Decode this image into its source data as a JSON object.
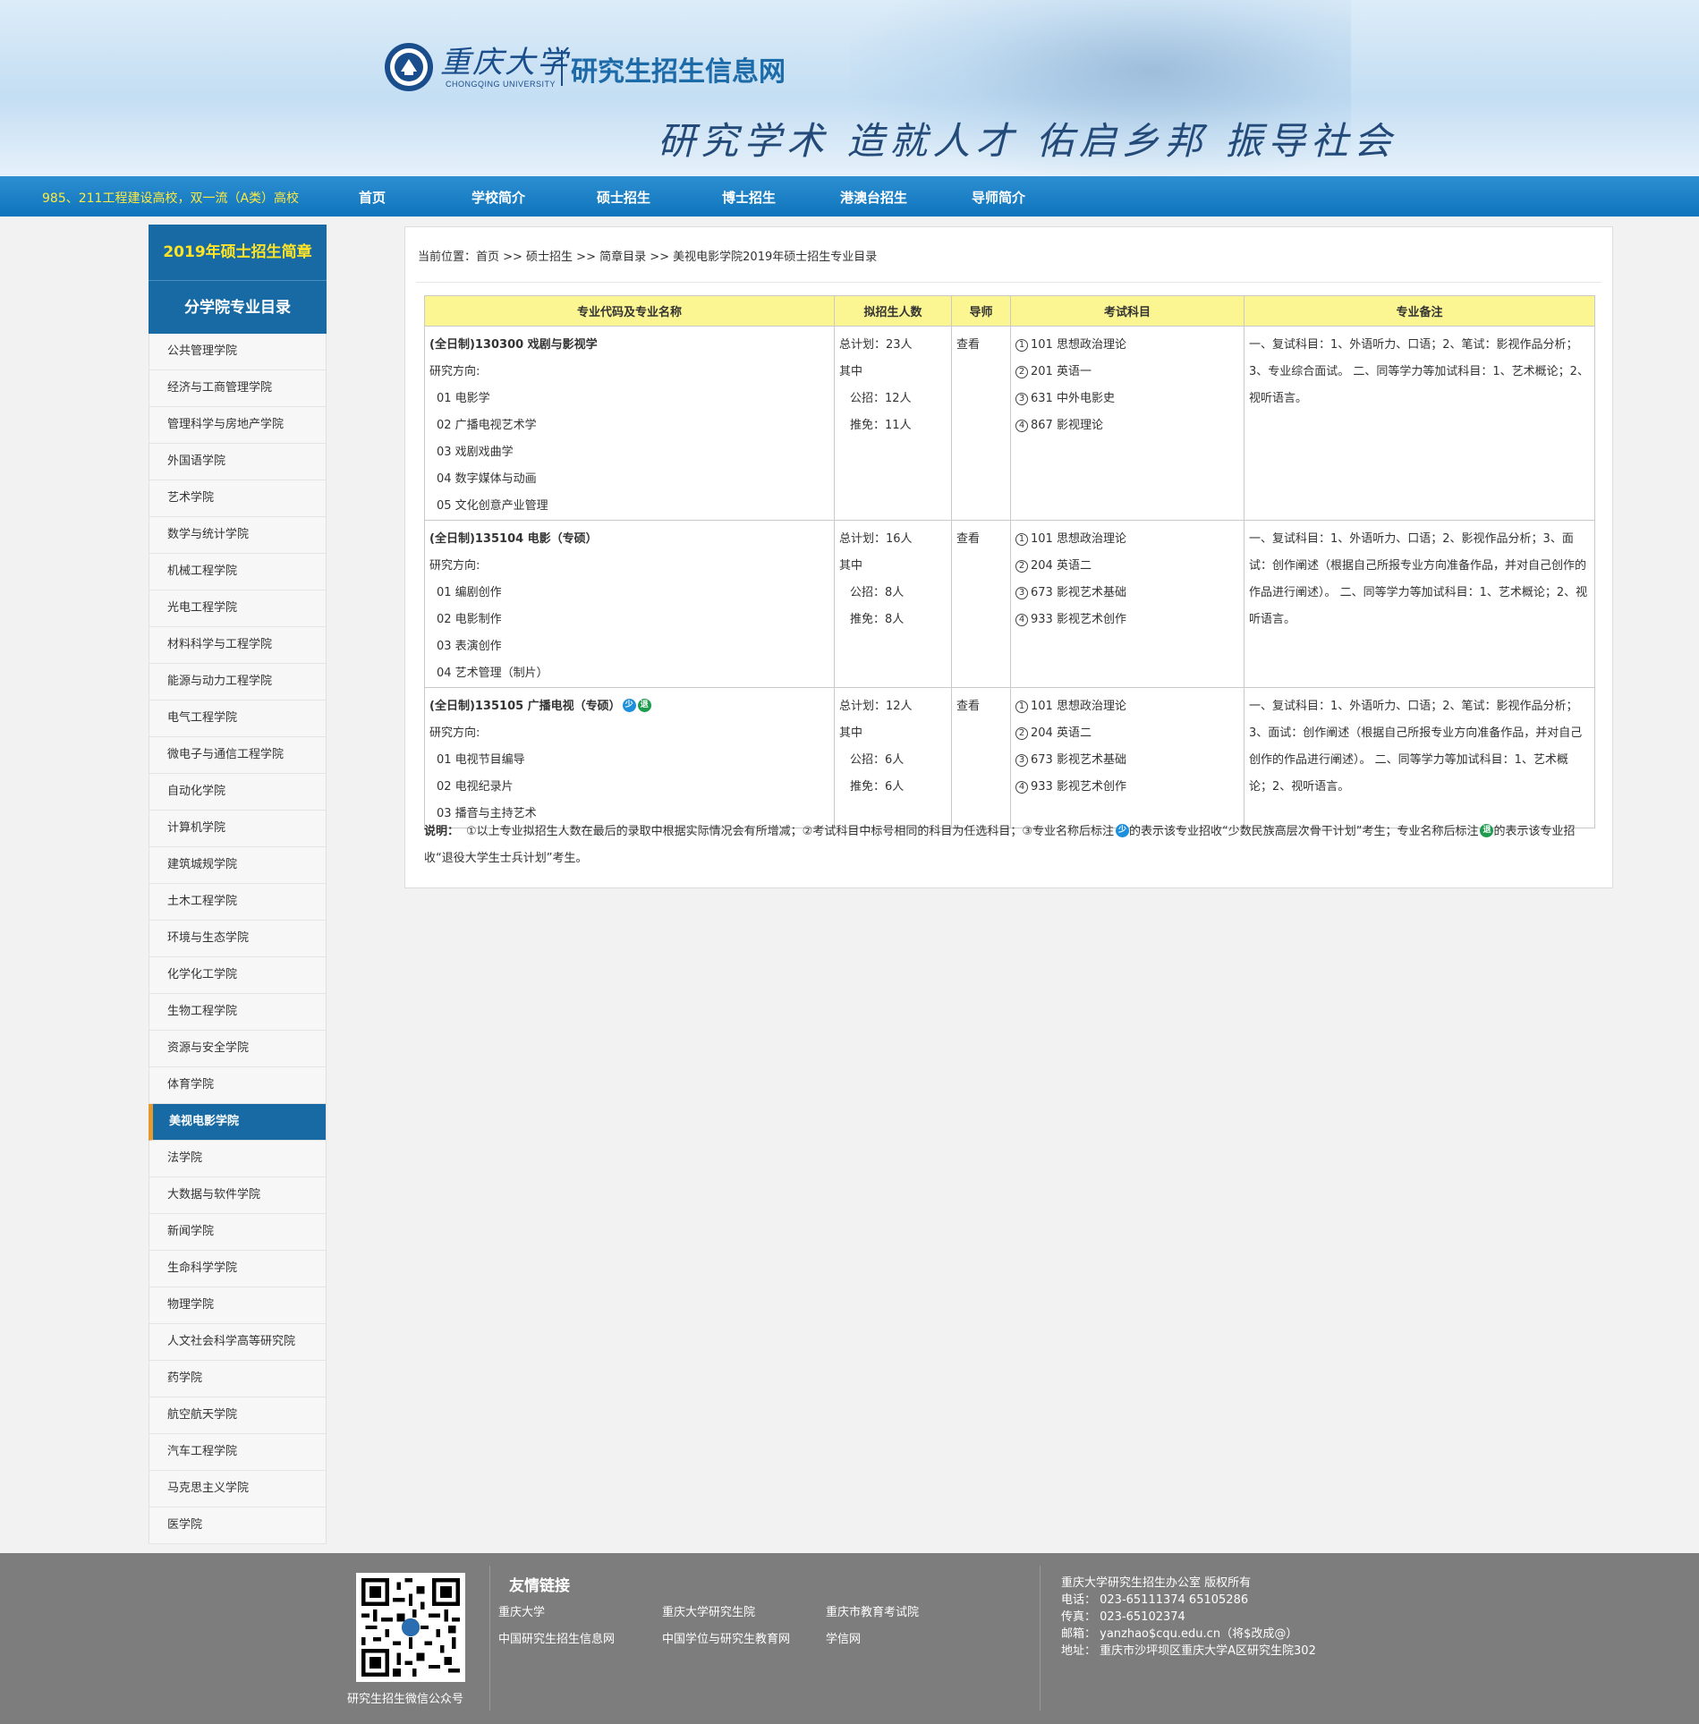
{
  "header": {
    "logo_cn": "重庆大学",
    "logo_en": "CHONGQING UNIVERSITY",
    "site_title": "研究生招生信息网",
    "slogan": "研究学术 造就人才 佑启乡邦 振导社会"
  },
  "nav": {
    "tagline": "985、211工程建设高校，双一流（A类）高校",
    "items": [
      "首页",
      "学校简介",
      "硕士招生",
      "博士招生",
      "港澳台招生",
      "导师简介"
    ]
  },
  "sidebar": {
    "heading1": "2019年硕士招生简章",
    "heading2": "分学院专业目录",
    "items": [
      "公共管理学院",
      "经济与工商管理学院",
      "管理科学与房地产学院",
      "外国语学院",
      "艺术学院",
      "数学与统计学院",
      "机械工程学院",
      "光电工程学院",
      "材料科学与工程学院",
      "能源与动力工程学院",
      "电气工程学院",
      "微电子与通信工程学院",
      "自动化学院",
      "计算机学院",
      "建筑城规学院",
      "土木工程学院",
      "环境与生态学院",
      "化学化工学院",
      "生物工程学院",
      "资源与安全学院",
      "体育学院",
      "美视电影学院",
      "法学院",
      "大数据与软件学院",
      "新闻学院",
      "生命科学学院",
      "物理学院",
      "人文社会科学高等研究院",
      "药学院",
      "航空航天学院",
      "汽车工程学院",
      "马克思主义学院",
      "医学院"
    ],
    "active_index": 21
  },
  "breadcrumb": "当前位置：首页 >> 硕士招生 >> 简章目录 >> 美视电影学院2019年硕士招生专业目录",
  "table": {
    "headers": [
      "专业代码及专业名称",
      "拟招生人数",
      "导师",
      "考试科目",
      "专业备注"
    ],
    "rows": [
      {
        "title": "(全日制)130300 戏剧与影视学",
        "directions_label": "研究方向:",
        "directions": [
          "01 电影学",
          "02 广播电视艺术学",
          "03 戏剧戏曲学",
          "04 数字媒体与动画",
          "05 文化创意产业管理"
        ],
        "quota_total": "总计划：23人",
        "quota_label": "其中",
        "quota_public": "公招：12人",
        "quota_recommend": "推免：11人",
        "supervisor": "查看",
        "exams": [
          {
            "num": "1",
            "text": "101 思想政治理论"
          },
          {
            "num": "2",
            "text": "201 英语一"
          },
          {
            "num": "3",
            "text": "631 中外电影史"
          },
          {
            "num": "4",
            "text": "867 影视理论"
          }
        ],
        "remark": "一、复试科目：1、外语听力、口语；2、笔试：影视作品分析；3、专业综合面试。 二、同等学力等加试科目：1、艺术概论；2、视听语言。",
        "badges": []
      },
      {
        "title": "(全日制)135104 电影（专硕）",
        "directions_label": "研究方向:",
        "directions": [
          "01 编剧创作",
          "02 电影制作",
          "03 表演创作",
          "04 艺术管理（制片）"
        ],
        "quota_total": "总计划：16人",
        "quota_label": "其中",
        "quota_public": "公招：8人",
        "quota_recommend": "推免：8人",
        "supervisor": "查看",
        "exams": [
          {
            "num": "1",
            "text": "101 思想政治理论"
          },
          {
            "num": "2",
            "text": "204 英语二"
          },
          {
            "num": "3",
            "text": "673 影视艺术基础"
          },
          {
            "num": "4",
            "text": "933 影视艺术创作"
          }
        ],
        "remark": "一、复试科目：1、外语听力、口语；2、影视作品分析；3、面试：创作阐述（根据自己所报专业方向准备作品，并对自己创作的作品进行阐述）。 二、同等学力等加试科目：1、艺术概论；2、视听语言。",
        "badges": []
      },
      {
        "title": "(全日制)135105 广播电视（专硕）",
        "directions_label": "研究方向:",
        "directions": [
          "01 电视节目编导",
          "02 电视纪录片",
          "03 播音与主持艺术"
        ],
        "quota_total": "总计划：12人",
        "quota_label": "其中",
        "quota_public": "公招：6人",
        "quota_recommend": "推免：6人",
        "supervisor": "查看",
        "exams": [
          {
            "num": "1",
            "text": "101 思想政治理论"
          },
          {
            "num": "2",
            "text": "204 英语二"
          },
          {
            "num": "3",
            "text": "673 影视艺术基础"
          },
          {
            "num": "4",
            "text": "933 影视艺术创作"
          }
        ],
        "remark": "一、复试科目：1、外语听力、口语；2、笔试：影视作品分析；3、面试：创作阐述（根据自己所报专业方向准备作品，并对自己创作的作品进行阐述）。 二、同等学力等加试科目：1、艺术概论；2、视听语言。",
        "badges": [
          "少",
          "退"
        ]
      }
    ]
  },
  "notes": {
    "label": "说明：",
    "part1": "①以上专业拟招生人数在最后的录取中根据实际情况会有所增减；②考试科目中标号相同的科目为任选科目；③专业名称后标注",
    "badge_minority": "少",
    "part2": "的表示该专业招收“少数民族高层次骨干计划”考生；专业名称后标注",
    "badge_veteran": "退",
    "part3": "的表示该专业招收“退役大学生士兵计划”考生。"
  },
  "footer": {
    "qr_caption": "研究生招生微信公众号",
    "links_title": "友情链接",
    "links": [
      "重庆大学",
      "重庆大学研究生院",
      "重庆市教育考试院",
      "中国研究生招生信息网",
      "中国学位与研究生教育网",
      "学信网"
    ],
    "info": [
      "重庆大学研究生招生办公室  版权所有",
      "电话：  023-65111374 65105286",
      "传真：  023-65102374",
      "邮箱：  yanzhao$cqu.edu.cn（将$改成@）",
      "地址：  重庆市沙坪坝区重庆大学A区研究生院302"
    ]
  },
  "colors": {
    "nav_blue": "#0f74bd",
    "sidebar_blue": "#176aa3",
    "header_yellow": "#fbf692",
    "tagline_yellow": "#ffea3f",
    "active_accent": "#e39a2f",
    "footer_gray": "#7d7d7d"
  },
  "icons": [
    "school-emblem-icon",
    "qr-code-icon",
    "minority-badge-icon",
    "veteran-badge-icon"
  ]
}
